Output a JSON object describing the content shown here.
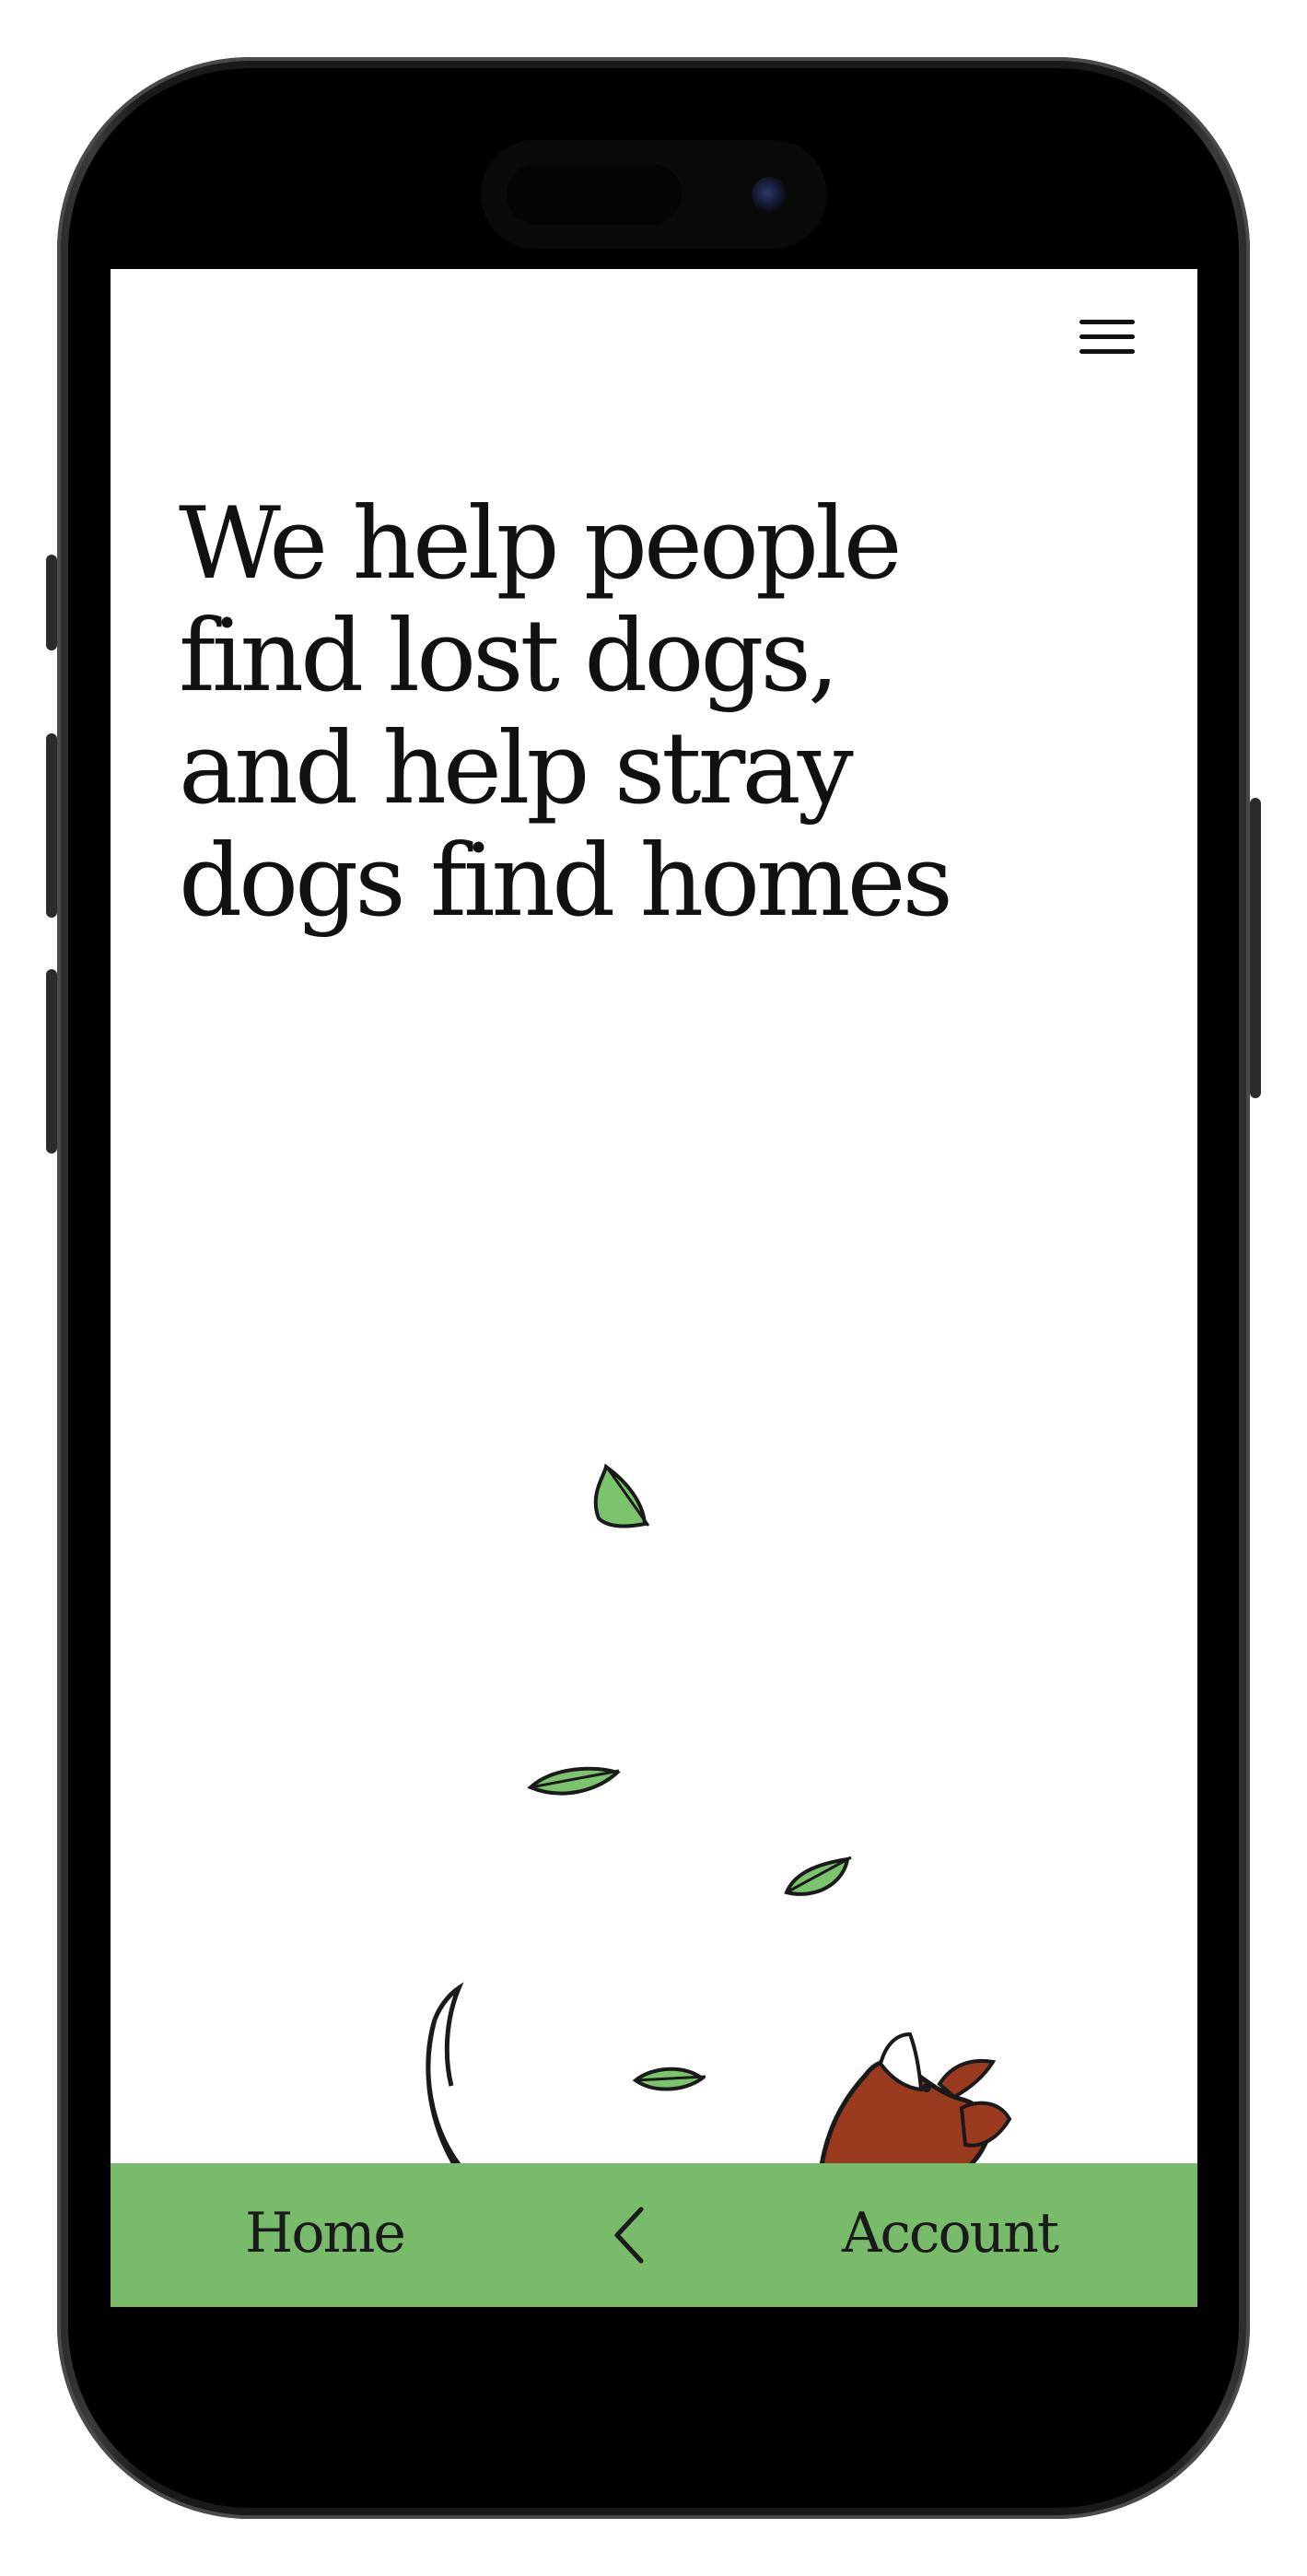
{
  "screen": {
    "menu_icon": "hamburger-menu-icon",
    "hero_title": "We help people find lost dogs, and help stray dogs find homes",
    "illustration": {
      "subject": "dog-running-with-leaves",
      "colors": {
        "dog_fur": "#9a3b1f",
        "dog_chest": "#ffffff",
        "outline": "#1a1a1a",
        "leaf": "#7cc36e"
      }
    },
    "bottom_nav": {
      "background": "#77bb6b",
      "home_label": "Home",
      "back_icon": "chevron-left-icon",
      "account_label": "Account"
    }
  }
}
